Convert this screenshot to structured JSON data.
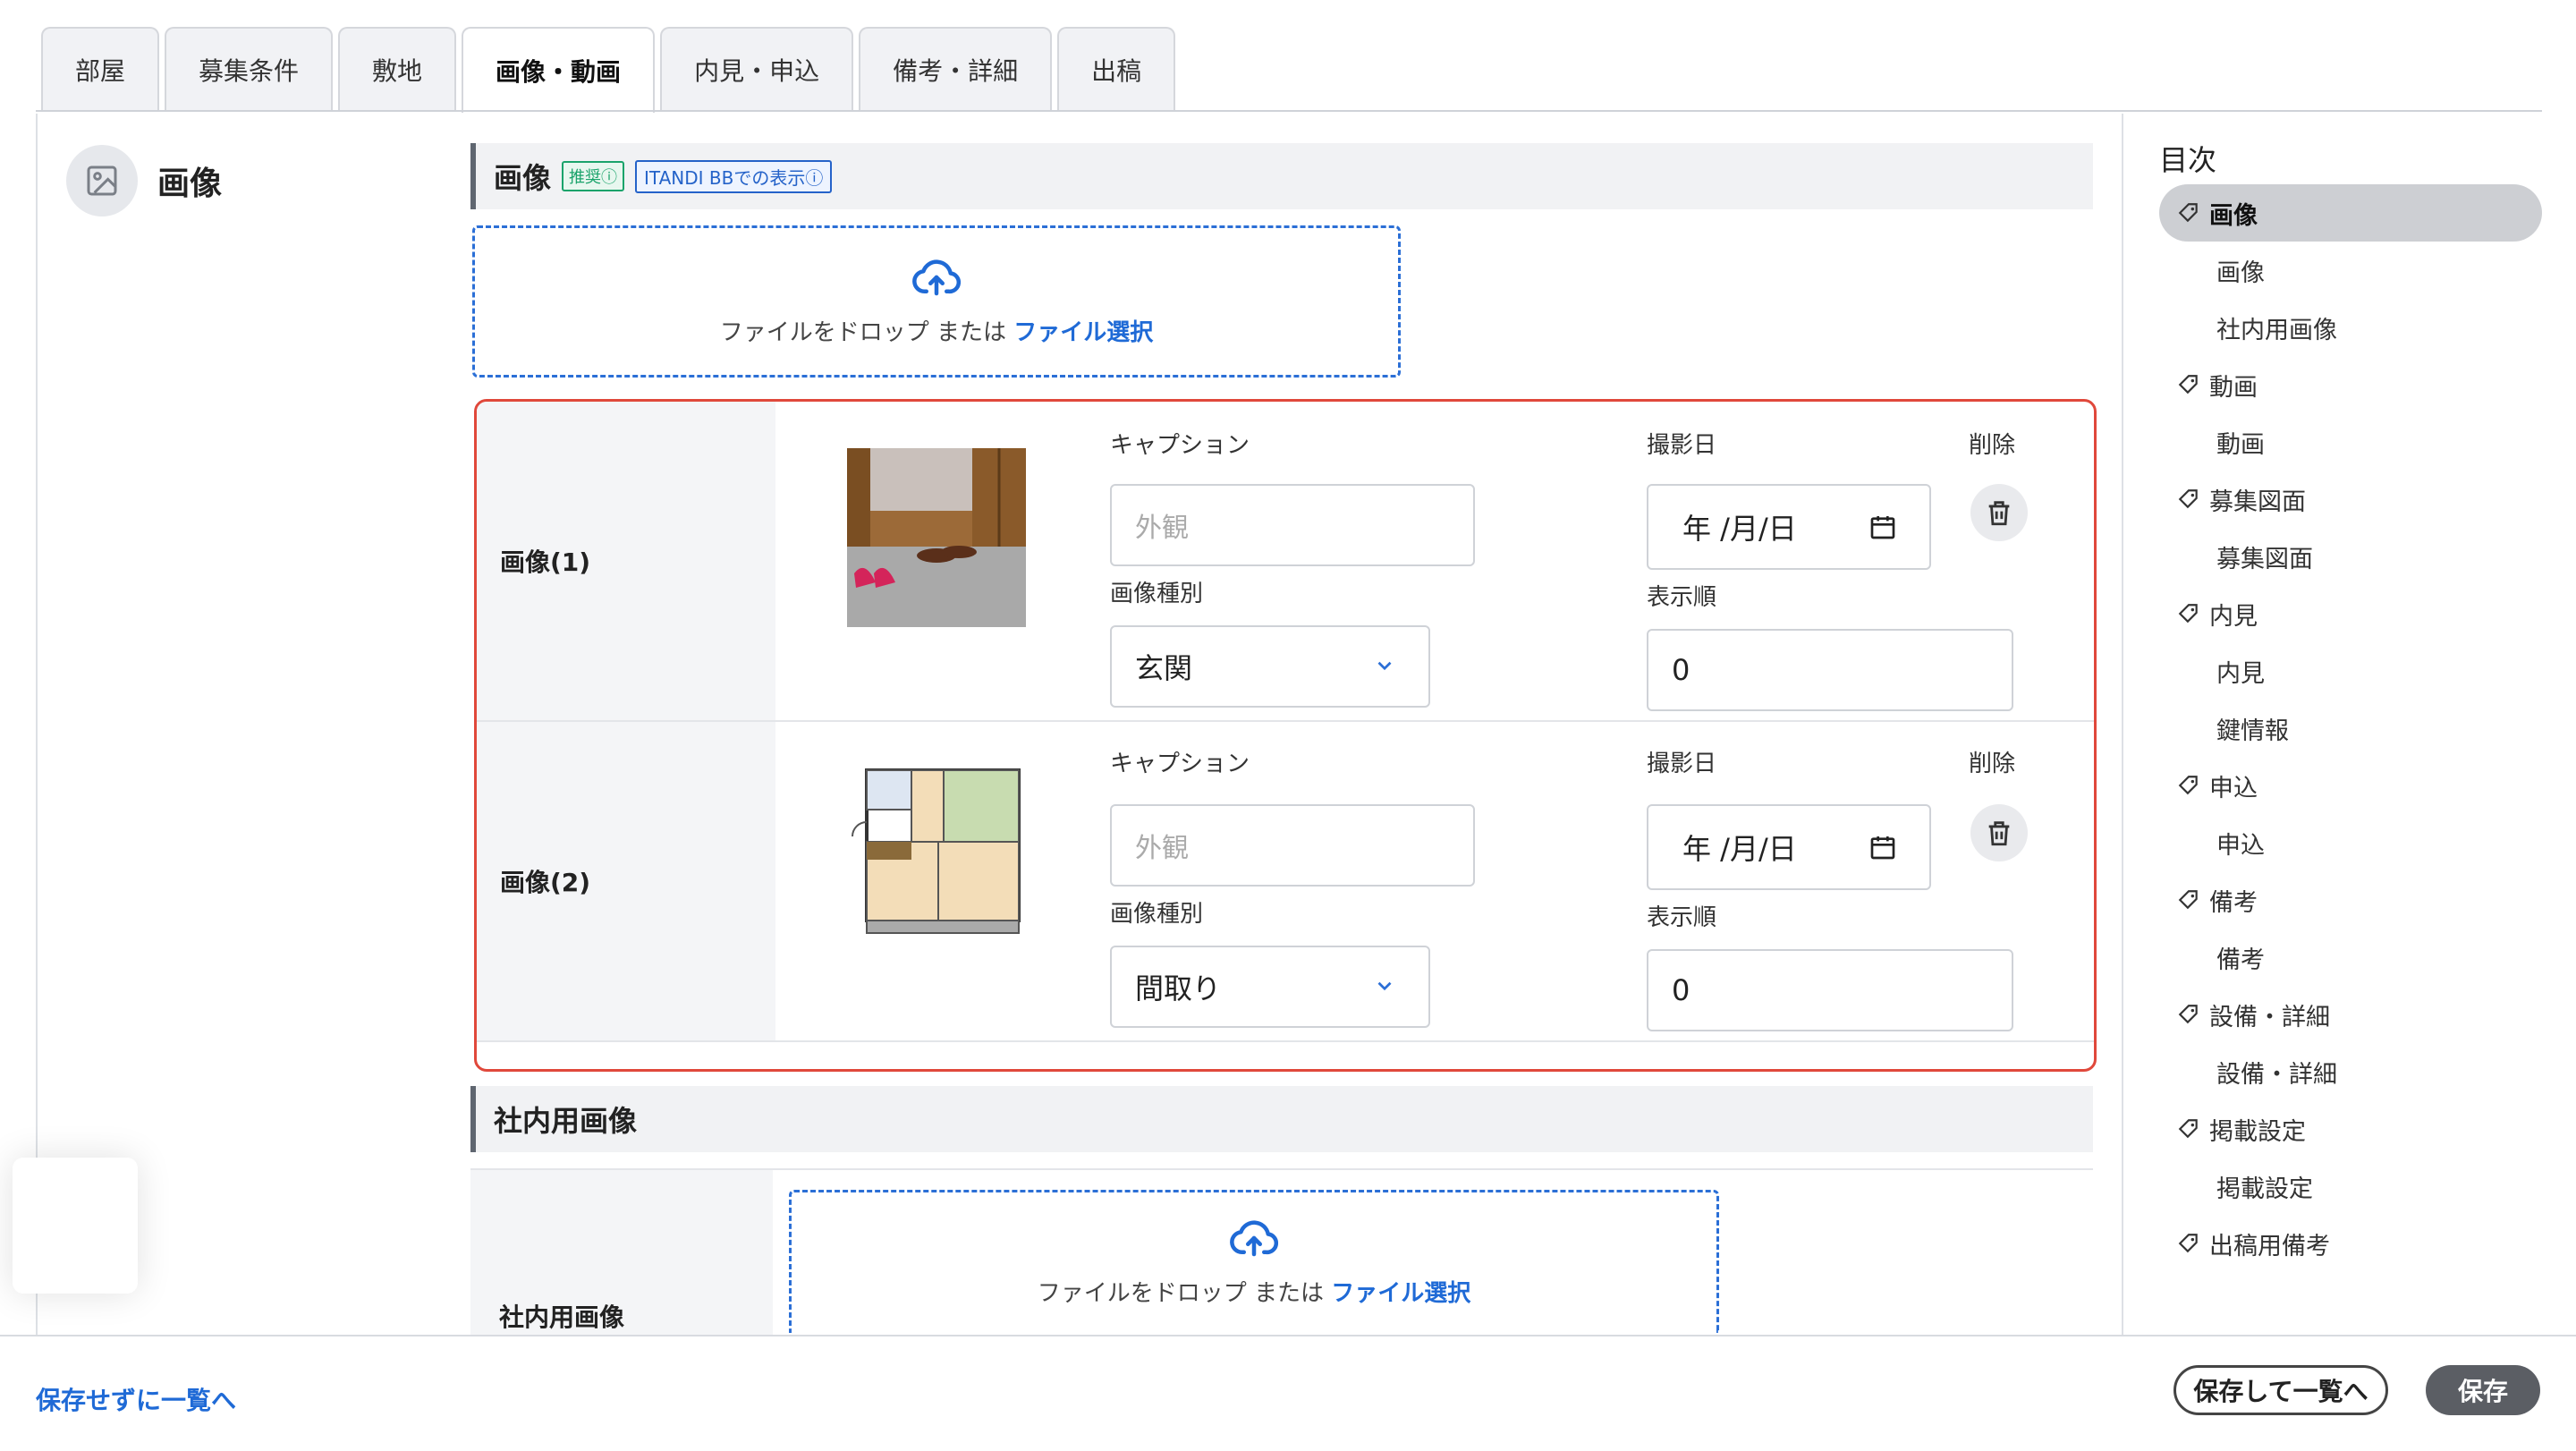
{
  "tabs": [
    "部屋",
    "募集条件",
    "敷地",
    "画像・動画",
    "内見・申込",
    "備考・詳細",
    "出稿"
  ],
  "section": {
    "title": "画像",
    "icon": "image-icon"
  },
  "image_header": {
    "title": "画像",
    "badge_recommended": "推奨",
    "badge_itandi": "ITANDI BBでの表示"
  },
  "dropzone": {
    "text": "ファイルをドロップ または ",
    "link": "ファイル選択",
    "icon": "upload-cloud-icon"
  },
  "images": [
    {
      "label": "画像(1)",
      "caption_label": "キャプション",
      "caption_placeholder": "外観",
      "type_label": "画像種別",
      "type_value": "玄関",
      "date_label": "撮影日",
      "date_value": "年 /月/日",
      "order_label": "表示順",
      "order_value": "0",
      "delete_label": "削除"
    },
    {
      "label": "画像(2)",
      "caption_label": "キャプション",
      "caption_placeholder": "外観",
      "type_label": "画像種別",
      "type_value": "間取り",
      "date_label": "撮影日",
      "date_value": "年 /月/日",
      "order_label": "表示順",
      "order_value": "0",
      "delete_label": "削除"
    }
  ],
  "internal": {
    "title": "社内用画像",
    "label": "社内用画像"
  },
  "toc": {
    "title": "目次",
    "items": [
      {
        "label": "画像",
        "parent": true,
        "active": true
      },
      {
        "label": "画像",
        "parent": false
      },
      {
        "label": "社内用画像",
        "parent": false
      },
      {
        "label": "動画",
        "parent": true
      },
      {
        "label": "動画",
        "parent": false
      },
      {
        "label": "募集図面",
        "parent": true
      },
      {
        "label": "募集図面",
        "parent": false
      },
      {
        "label": "内見",
        "parent": true
      },
      {
        "label": "内見",
        "parent": false
      },
      {
        "label": "鍵情報",
        "parent": false
      },
      {
        "label": "申込",
        "parent": true
      },
      {
        "label": "申込",
        "parent": false
      },
      {
        "label": "備考",
        "parent": true
      },
      {
        "label": "備考",
        "parent": false
      },
      {
        "label": "設備・詳細",
        "parent": true
      },
      {
        "label": "設備・詳細",
        "parent": false
      },
      {
        "label": "掲載設定",
        "parent": true
      },
      {
        "label": "掲載設定",
        "parent": false
      },
      {
        "label": "出稿用備考",
        "parent": true
      }
    ]
  },
  "footer": {
    "back_link": "保存せずに一覧へ",
    "save_back": "保存して一覧へ",
    "save": "保存"
  },
  "colors": {
    "accent": "#1f6ad6",
    "highlight_border": "#e0483b",
    "recommended": "#1aa36b"
  }
}
